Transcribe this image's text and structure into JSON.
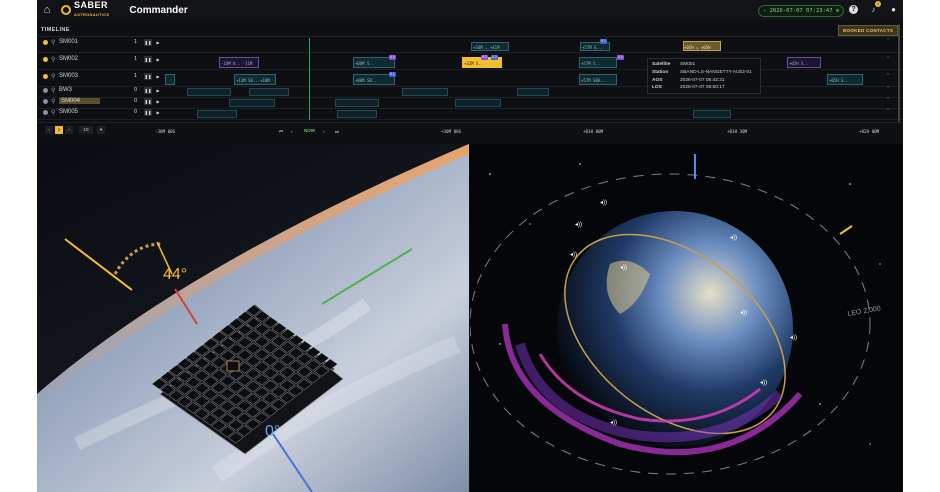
{
  "app": {
    "brand": "SABER",
    "brand_sub": "ASTRONAUTICS",
    "title": "Commander",
    "clock": "‹ 2026-07-07 07:23:47 ⚙",
    "notification_count": "1"
  },
  "timeline": {
    "title": "TIMELINE",
    "booked_label": "BOOKED CONTACTS",
    "rows": [
      {
        "name": "SM001",
        "count": "1",
        "pin_color": "#f2c02e"
      },
      {
        "name": "SM002",
        "count": "1",
        "pin_color": "#f2c02e"
      },
      {
        "name": "SM003",
        "count": "1",
        "pin_color": "#f2c02e"
      },
      {
        "name": "BW3",
        "count": "0",
        "pin_color": "#8a9099"
      },
      {
        "name": "SM004",
        "count": "0",
        "pin_color": "#8a9099"
      },
      {
        "name": "SM005",
        "count": "0",
        "pin_color": "#8a9099"
      }
    ],
    "contact_labels": {
      "c1": "+34M ↘ +41M",
      "c2": "+57M S..",
      "c3": "+05H ↘ +05H",
      "c4": "-18M O.. -11M",
      "c5": "+08M S..",
      "c6": "+32M S..",
      "c7": "+57M S..",
      "c8": "+05H S..",
      "c9": "+13M SB.. +18M",
      "c10": "+08M SB..",
      "c11": "+57M SBA..",
      "c12": "+05H S.."
    },
    "markers": [
      "0 1",
      "0 1",
      "0 2",
      "0 2",
      "0 1",
      "1 1"
    ],
    "popup": {
      "satellite_key": "Satellite",
      "satellite_val": "SM001",
      "station_key": "Station",
      "station_val": "SBAND-LS-NANGETTY-AU02-01",
      "aos_key": "AOS",
      "aos_val": "2026-07-07 08:42:31",
      "los_key": "LOS",
      "los_val": "2026-07-07 08:50:17"
    },
    "footer": {
      "page_first": "1",
      "page_size": "10",
      "now_label": "NOW",
      "ticks": [
        "-30M 00S",
        "+30M 00S",
        "+01H 00M",
        "+01H 30M",
        "+02H 00M"
      ]
    }
  },
  "viewport_left": {
    "angle_top": "44°",
    "angle_bottom": "0°"
  },
  "viewport_right": {
    "orbit_label": "LEO 2,000"
  },
  "colors": {
    "accent": "#f0b83a",
    "now_line": "#2ea84a",
    "contact_teal": "#2d6470",
    "contact_purple": "#6a4a9a",
    "ring_magenta": "#c03ad0"
  }
}
